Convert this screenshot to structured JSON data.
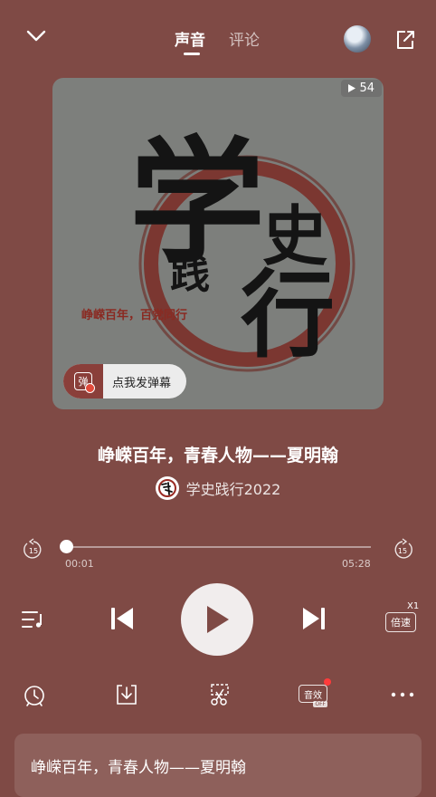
{
  "header": {
    "tabs": [
      {
        "label": "声音",
        "active": true
      },
      {
        "label": "评论",
        "active": false
      }
    ]
  },
  "cover": {
    "play_count": "54",
    "art_text": {
      "big_char_1": "学",
      "big_char_2": "史",
      "big_char_3": "践",
      "big_char_4": "行",
      "subtitle": "峥嵘百年，百党同行"
    },
    "danmaku_label": "点我发弹幕",
    "danmaku_icon_char": "弹"
  },
  "track": {
    "title": "峥嵘百年，青春人物——夏明翰",
    "author": "学史践行2022",
    "current_time": "00:01",
    "total_time": "05:28",
    "progress": 0.003,
    "skip_seconds": "15"
  },
  "controls": {
    "speed_label": "倍速",
    "speed_value": "X1",
    "effect_label": "音效",
    "effect_state": "OFF"
  },
  "bottom_card": {
    "title": "峥嵘百年，青春人物——夏明翰"
  },
  "colors": {
    "background": "#7f4a45",
    "play_button_bg": "#f1eded",
    "danmaku_accent": "#8a3f3a",
    "effect_dot": "#ff3b3b"
  }
}
